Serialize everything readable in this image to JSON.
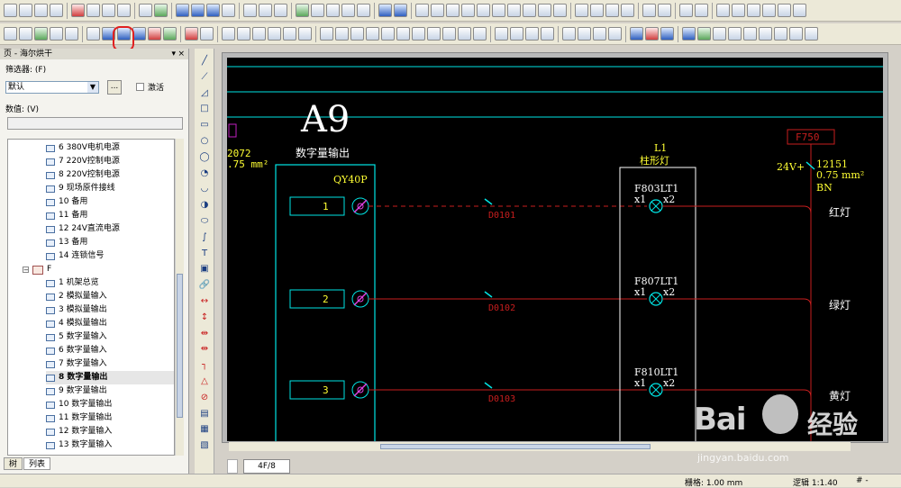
{
  "panel": {
    "title": "页 - 海尔烘干",
    "close": "×",
    "pin": "▾",
    "filter_label": "筛选器: (F)",
    "filter_value": "默认",
    "ellipsis": "...",
    "activate_label": "激活",
    "value_label": "数值: (V)",
    "tabs": [
      "树",
      "列表"
    ]
  },
  "tree": {
    "items_upper": [
      "6 380V电机电源",
      "7 220V控制电源",
      "8 220V控制电源",
      "9 现场原件接线",
      "10 备用",
      "11 备用",
      "12 24V直流电源",
      "13 备用",
      "14 连锁信号"
    ],
    "group_label": "F",
    "group_expander": "−",
    "items_lower": [
      "1 机架总览",
      "2 模拟量输入",
      "3 模拟量输出",
      "4 模拟量输出",
      "5 数字量输入",
      "6 数字量输入",
      "7 数字量输入",
      "8 数字量输出",
      "9 数字量输出",
      "10 数字量输出",
      "11 数字量输出",
      "12 数字量输入",
      "13 数字量输入"
    ],
    "selected_index": 7
  },
  "schematic": {
    "title": "A9",
    "subtitle": "数字量输出",
    "module": "QY40P",
    "left_partial_top": "2072",
    "left_partial_mid": ".75 mm²",
    "channels": [
      "1",
      "2",
      "3"
    ],
    "wires": [
      "D0101",
      "D0102",
      "D0103"
    ],
    "lamp_box_title1": "L1",
    "lamp_box_title2": "柱形灯",
    "lamps": [
      {
        "tag": "F803LT1",
        "x1": "x1",
        "x2": "x2",
        "label": "红灯"
      },
      {
        "tag": "F807LT1",
        "x1": "x1",
        "x2": "x2",
        "label": "绿灯"
      },
      {
        "tag": "F810LT1",
        "x1": "x1",
        "x2": "x2",
        "label": "黄灯"
      }
    ],
    "fuse_tag": "F750",
    "supply": "24V+",
    "cable_no": "12151",
    "cable_size": "0.75 mm²",
    "cable_color": "BN",
    "colors": {
      "cyan": "#00e5e5",
      "yellow": "#ffff33",
      "red": "#c81e1e",
      "white": "#ffffff",
      "magenta": "#e040e0"
    }
  },
  "sheet_tab": "4F/8",
  "status": {
    "grid": "栅格: 1.00 mm",
    "logic": "逻辑 1:1.40",
    "hash": "# -"
  },
  "watermark": {
    "brand": "Bai",
    "brand_cn": "经验",
    "url": "jingyan.baidu.com"
  }
}
